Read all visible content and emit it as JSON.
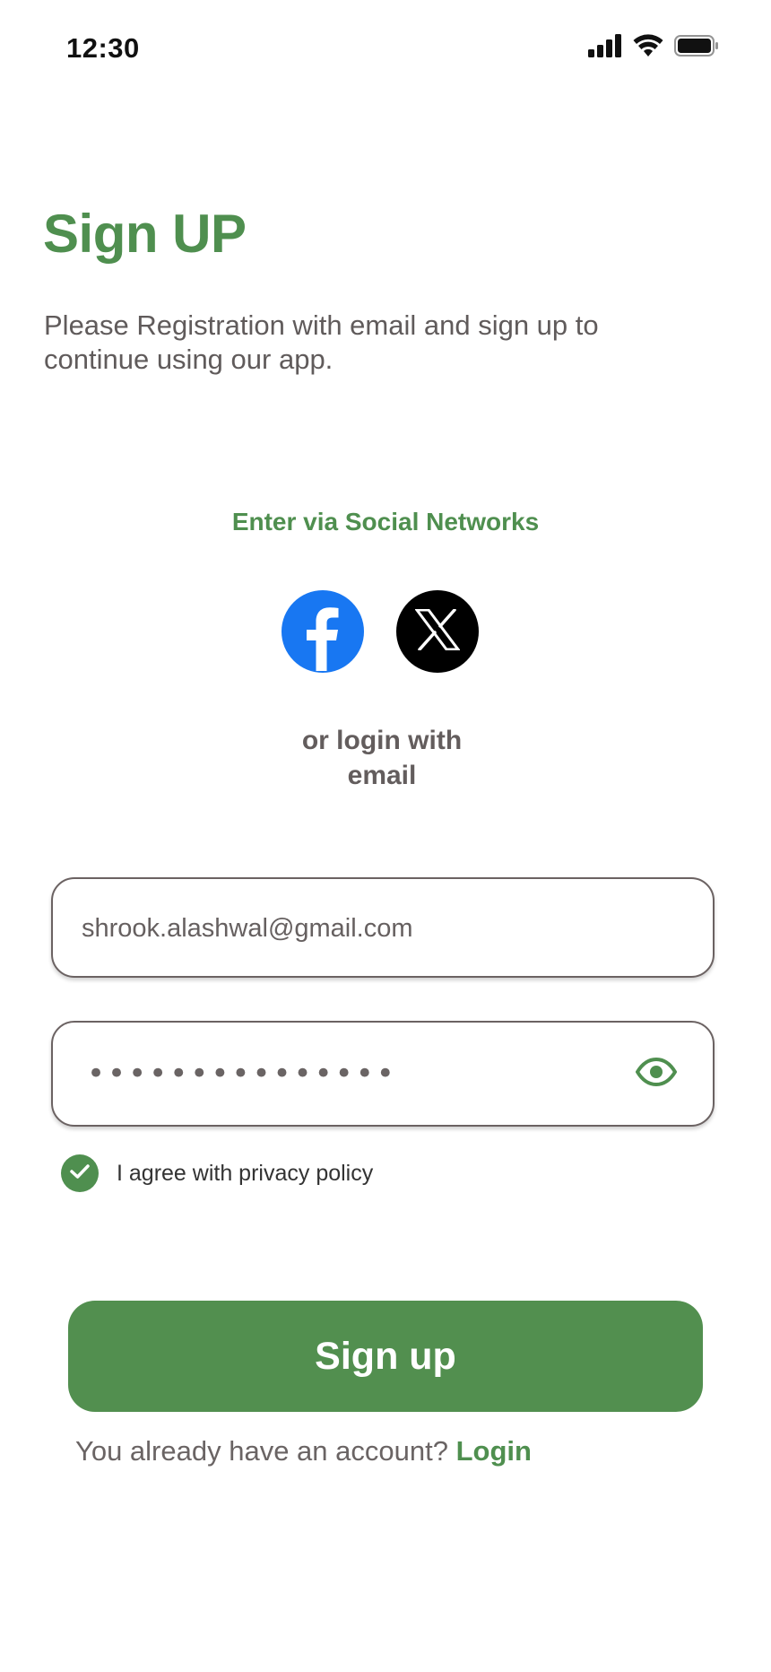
{
  "status_bar": {
    "time": "12:30",
    "icons": [
      "cellular-signal-icon",
      "wifi-icon",
      "battery-icon"
    ]
  },
  "header": {
    "title": "Sign UP",
    "subtitle": "Please Registration with email and sign up to continue using our app."
  },
  "social": {
    "heading": "Enter via Social Networks",
    "buttons": [
      "facebook-icon",
      "x-twitter-icon"
    ],
    "or_line1": "or login with",
    "or_line2": "email"
  },
  "form": {
    "email_value": "shrook.alashwal@gmail.com",
    "password_masked": "•••••••••••••••",
    "agree_label": "I agree with privacy policy",
    "agree_checked": true
  },
  "actions": {
    "signup_label": "Sign up",
    "account_prompt": "You already have an account?",
    "login_label": "Login"
  },
  "colors": {
    "accent": "#4f8f4f",
    "facebook": "#1877f2",
    "x": "#000000",
    "text_muted": "#605b5b"
  }
}
